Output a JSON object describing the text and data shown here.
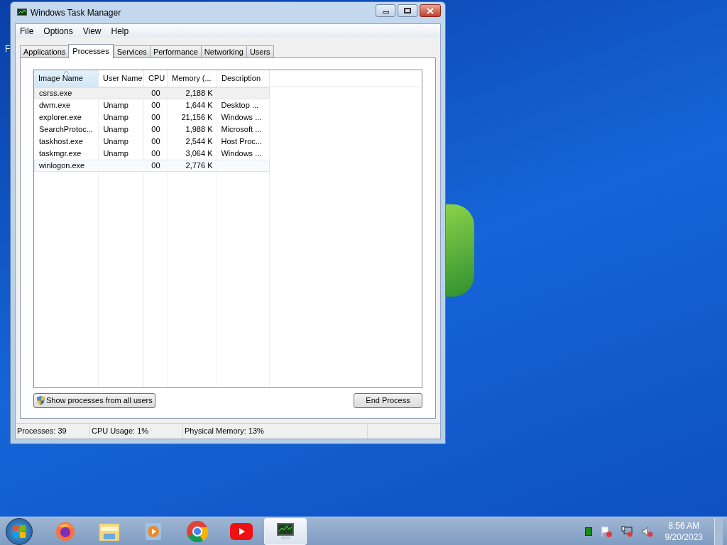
{
  "desktop": {
    "cut_label": "F"
  },
  "window": {
    "title": "Windows Task Manager"
  },
  "menu": [
    "File",
    "Options",
    "View",
    "Help"
  ],
  "tabs": [
    {
      "label": "Applications",
      "selected": false
    },
    {
      "label": "Processes",
      "selected": true
    },
    {
      "label": "Services",
      "selected": false
    },
    {
      "label": "Performance",
      "selected": false
    },
    {
      "label": "Networking",
      "selected": false
    },
    {
      "label": "Users",
      "selected": false
    }
  ],
  "table": {
    "columns": [
      {
        "label": "Image Name",
        "sorted": true
      },
      {
        "label": "User Name",
        "sorted": false
      },
      {
        "label": "CPU",
        "sorted": false
      },
      {
        "label": "Memory (...",
        "sorted": false
      },
      {
        "label": "Description",
        "sorted": false
      }
    ],
    "rows": [
      {
        "cells": [
          "csrss.exe",
          "",
          "00",
          "2,188 K",
          ""
        ],
        "selected": true,
        "hovered": false
      },
      {
        "cells": [
          "dwm.exe",
          "Unamp",
          "00",
          "1,644 K",
          "Desktop ..."
        ],
        "selected": false,
        "hovered": false
      },
      {
        "cells": [
          "explorer.exe",
          "Unamp",
          "00",
          "21,156 K",
          "Windows ..."
        ],
        "selected": false,
        "hovered": false
      },
      {
        "cells": [
          "SearchProtoc...",
          "Unamp",
          "00",
          "1,988 K",
          "Microsoft ..."
        ],
        "selected": false,
        "hovered": false
      },
      {
        "cells": [
          "taskhost.exe",
          "Unamp",
          "00",
          "2,544 K",
          "Host Proc..."
        ],
        "selected": false,
        "hovered": false
      },
      {
        "cells": [
          "taskmgr.exe",
          "Unamp",
          "00",
          "3,064 K",
          "Windows ..."
        ],
        "selected": false,
        "hovered": false
      },
      {
        "cells": [
          "winlogon.exe",
          "",
          "00",
          "2,776 K",
          ""
        ],
        "selected": false,
        "hovered": true
      }
    ]
  },
  "buttons": {
    "show_all": "Show processes from all users",
    "end": "End Process"
  },
  "status_bar": [
    "Processes: 39",
    "CPU Usage: 1%",
    "Physical Memory: 13%"
  ],
  "taskbar": {
    "apps": [
      {
        "kind": "firefox",
        "active": false
      },
      {
        "kind": "explorer",
        "active": false
      },
      {
        "kind": "media",
        "active": false
      },
      {
        "kind": "chrome",
        "active": false
      },
      {
        "kind": "youtube",
        "active": false
      },
      {
        "kind": "taskmgr",
        "active": true
      }
    ],
    "clock": {
      "time": "8:56 AM",
      "date": "9/20/2023"
    }
  }
}
